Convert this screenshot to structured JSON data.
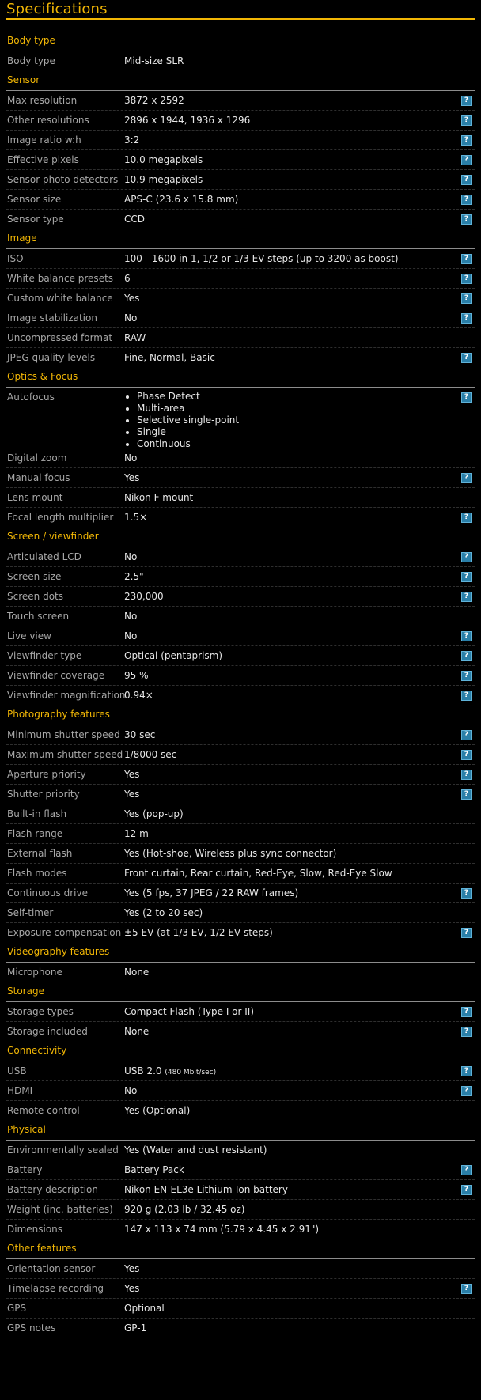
{
  "page_title": "Specifications",
  "help_label": "?",
  "sections": [
    {
      "title": "Body type",
      "rows": [
        {
          "label": "Body type",
          "value": "Mid-size SLR",
          "help": false
        }
      ]
    },
    {
      "title": "Sensor",
      "rows": [
        {
          "label": "Max resolution",
          "value": "3872 x 2592",
          "help": true
        },
        {
          "label": "Other resolutions",
          "value": "2896 x 1944, 1936 x 1296",
          "help": true
        },
        {
          "label": "Image ratio w:h",
          "value": "3:2",
          "help": true
        },
        {
          "label": "Effective pixels",
          "value": "10.0 megapixels",
          "help": true
        },
        {
          "label": "Sensor photo detectors",
          "value": "10.9 megapixels",
          "help": true
        },
        {
          "label": "Sensor size",
          "value": "APS-C (23.6 x 15.8 mm)",
          "help": true
        },
        {
          "label": "Sensor type",
          "value": "CCD",
          "help": true
        }
      ]
    },
    {
      "title": "Image",
      "rows": [
        {
          "label": "ISO",
          "value": "100 - 1600 in 1, 1/2 or 1/3 EV steps (up to 3200 as boost)",
          "help": true
        },
        {
          "label": "White balance presets",
          "value": "6",
          "help": true
        },
        {
          "label": "Custom white balance",
          "value": "Yes",
          "help": true
        },
        {
          "label": "Image stabilization",
          "value": "No",
          "help": true
        },
        {
          "label": "Uncompressed format",
          "value": "RAW",
          "help": false
        },
        {
          "label": "JPEG quality levels",
          "value": "Fine, Normal, Basic",
          "help": true
        }
      ]
    },
    {
      "title": "Optics & Focus",
      "rows": [
        {
          "label": "Autofocus",
          "list": [
            "Phase Detect",
            "Multi-area",
            "Selective single-point",
            "Single",
            "Continuous"
          ],
          "help": true
        },
        {
          "label": "Digital zoom",
          "value": "No",
          "help": false
        },
        {
          "label": "Manual focus",
          "value": "Yes",
          "help": true
        },
        {
          "label": "Lens mount",
          "value": "Nikon F mount",
          "help": false
        },
        {
          "label": "Focal length multiplier",
          "value": "1.5×",
          "help": true
        }
      ]
    },
    {
      "title": "Screen / viewfinder",
      "rows": [
        {
          "label": "Articulated LCD",
          "value": "No",
          "help": true
        },
        {
          "label": "Screen size",
          "value": "2.5\"",
          "help": true
        },
        {
          "label": "Screen dots",
          "value": "230,000",
          "help": true
        },
        {
          "label": "Touch screen",
          "value": "No",
          "help": false
        },
        {
          "label": "Live view",
          "value": "No",
          "help": true
        },
        {
          "label": "Viewfinder type",
          "value": "Optical (pentaprism)",
          "help": true
        },
        {
          "label": "Viewfinder coverage",
          "value": "95 %",
          "help": true
        },
        {
          "label": "Viewfinder magnification",
          "value": "0.94×",
          "help": true
        }
      ]
    },
    {
      "title": "Photography features",
      "rows": [
        {
          "label": "Minimum shutter speed",
          "value": "30 sec",
          "help": true
        },
        {
          "label": "Maximum shutter speed",
          "value": "1/8000 sec",
          "help": true
        },
        {
          "label": "Aperture priority",
          "value": "Yes",
          "help": true
        },
        {
          "label": "Shutter priority",
          "value": "Yes",
          "help": true
        },
        {
          "label": "Built-in flash",
          "value": "Yes (pop-up)",
          "help": false
        },
        {
          "label": "Flash range",
          "value": "12 m",
          "help": false
        },
        {
          "label": "External flash",
          "value": "Yes (Hot-shoe, Wireless plus sync connector)",
          "help": false
        },
        {
          "label": "Flash modes",
          "value": "Front curtain, Rear curtain, Red-Eye, Slow, Red-Eye Slow",
          "help": false
        },
        {
          "label": "Continuous drive",
          "value": "Yes (5 fps, 37 JPEG / 22 RAW frames)",
          "help": true
        },
        {
          "label": "Self-timer",
          "value": "Yes (2 to 20 sec)",
          "help": false
        },
        {
          "label": "Exposure compensation",
          "value": "±5 EV (at 1/3 EV, 1/2 EV steps)",
          "help": true
        }
      ]
    },
    {
      "title": "Videography features",
      "rows": [
        {
          "label": "Microphone",
          "value": "None",
          "help": false
        }
      ]
    },
    {
      "title": "Storage",
      "rows": [
        {
          "label": "Storage types",
          "value": "Compact Flash (Type I or II)",
          "help": true
        },
        {
          "label": "Storage included",
          "value": "None",
          "help": true
        }
      ]
    },
    {
      "title": "Connectivity",
      "rows": [
        {
          "label": "USB",
          "value": "USB 2.0",
          "value_small": "(480 Mbit/sec)",
          "help": true
        },
        {
          "label": "HDMI",
          "value": "No",
          "help": true
        },
        {
          "label": "Remote control",
          "value": "Yes (Optional)",
          "help": false
        }
      ]
    },
    {
      "title": "Physical",
      "rows": [
        {
          "label": "Environmentally sealed",
          "value": "Yes (Water and dust resistant)",
          "help": false
        },
        {
          "label": "Battery",
          "value": "Battery Pack",
          "help": true
        },
        {
          "label": "Battery description",
          "value": "Nikon EN-EL3e Lithium-Ion battery",
          "help": true
        },
        {
          "label": "Weight (inc. batteries)",
          "value": "920 g (2.03 lb / 32.45 oz)",
          "help": false
        },
        {
          "label": "Dimensions",
          "value": "147 x 113 x 74 mm (5.79 x 4.45 x 2.91\")",
          "help": false
        }
      ]
    },
    {
      "title": "Other features",
      "rows": [
        {
          "label": "Orientation sensor",
          "value": "Yes",
          "help": false
        },
        {
          "label": "Timelapse recording",
          "value": "Yes",
          "help": true
        },
        {
          "label": "GPS",
          "value": "Optional",
          "help": false
        },
        {
          "label": "GPS notes",
          "value": "GP-1",
          "help": false
        }
      ]
    }
  ]
}
